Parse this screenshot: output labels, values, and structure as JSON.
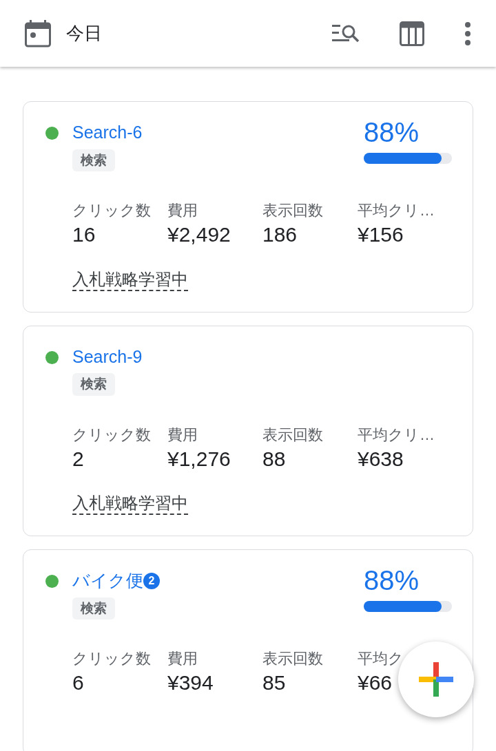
{
  "header": {
    "title": "今日"
  },
  "campaigns": [
    {
      "name": "Search-6",
      "color": "#4caf50",
      "type_tag": "検索",
      "score": {
        "text": "88%",
        "level": 0.88
      },
      "metrics": [
        {
          "label": "クリック数",
          "value": "16"
        },
        {
          "label": "費用",
          "value": "¥2,492"
        },
        {
          "label": "表示回数",
          "value": "186"
        },
        {
          "label": "平均クリ…",
          "value": "¥156"
        }
      ],
      "bid_status": "入札戦略学習中"
    },
    {
      "name": "Search-9",
      "color": "#4caf50",
      "type_tag": "検索",
      "metrics": [
        {
          "label": "クリック数",
          "value": "2"
        },
        {
          "label": "費用",
          "value": "¥1,276"
        },
        {
          "label": "表示回数",
          "value": "88"
        },
        {
          "label": "平均クリ…",
          "value": "¥638"
        }
      ],
      "bid_status": "入札戦略学習中"
    },
    {
      "name": "バイク便",
      "count_badge": "2",
      "color": "#4caf50",
      "type_tag": "検索",
      "score": {
        "text": "88%",
        "level": 0.88
      },
      "metrics": [
        {
          "label": "クリック数",
          "value": "6"
        },
        {
          "label": "費用",
          "value": "¥394"
        },
        {
          "label": "表示回数",
          "value": "85"
        },
        {
          "label": "平均ク",
          "value": "¥66"
        }
      ]
    }
  ]
}
